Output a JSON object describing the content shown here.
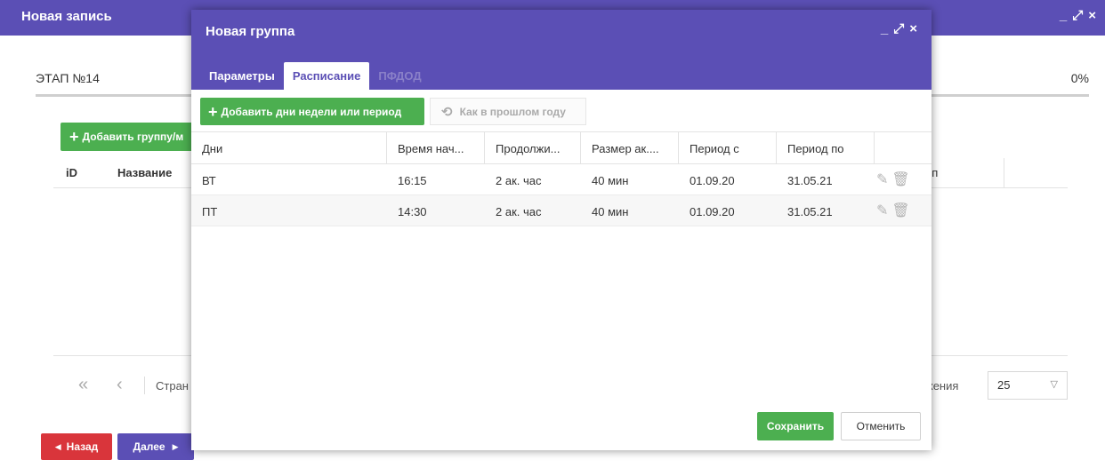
{
  "background": {
    "title": "Новая запись",
    "stage_label": "ЭТАП №14",
    "progress_percent": "0%",
    "add_group_label": "Добавить группу/м",
    "table_headers": [
      "iD",
      "Название",
      "ип"
    ],
    "pager_text": "Стран",
    "per_page_label": "жения",
    "per_page_value": "25",
    "back_label": "Назад",
    "next_label": "Далее"
  },
  "modal": {
    "title": "Новая группа",
    "tabs": [
      {
        "label": "Параметры",
        "state": "normal"
      },
      {
        "label": "Расписание",
        "state": "active"
      },
      {
        "label": "ПФДОД",
        "state": "disabled"
      }
    ],
    "toolbar": {
      "add_label": "Добавить дни недели или период",
      "like_last_year_label": "Как в прошлом году"
    },
    "columns": [
      "Дни",
      "Время нач...",
      "Продолжи...",
      "Размер ак....",
      "Период с",
      "Период по",
      ""
    ],
    "rows": [
      {
        "day": "ВТ",
        "start": "16:15",
        "duration": "2 ак. час",
        "size": "40 мин",
        "from": "01.09.20",
        "to": "31.05.21"
      },
      {
        "day": "ПТ",
        "start": "14:30",
        "duration": "2 ак. час",
        "size": "40 мин",
        "from": "01.09.20",
        "to": "31.05.21"
      }
    ],
    "save_label": "Сохранить",
    "cancel_label": "Отменить"
  },
  "colors": {
    "header_purple": "#5b4fb5",
    "button_green": "#4caf50",
    "button_red": "#d9353b"
  }
}
